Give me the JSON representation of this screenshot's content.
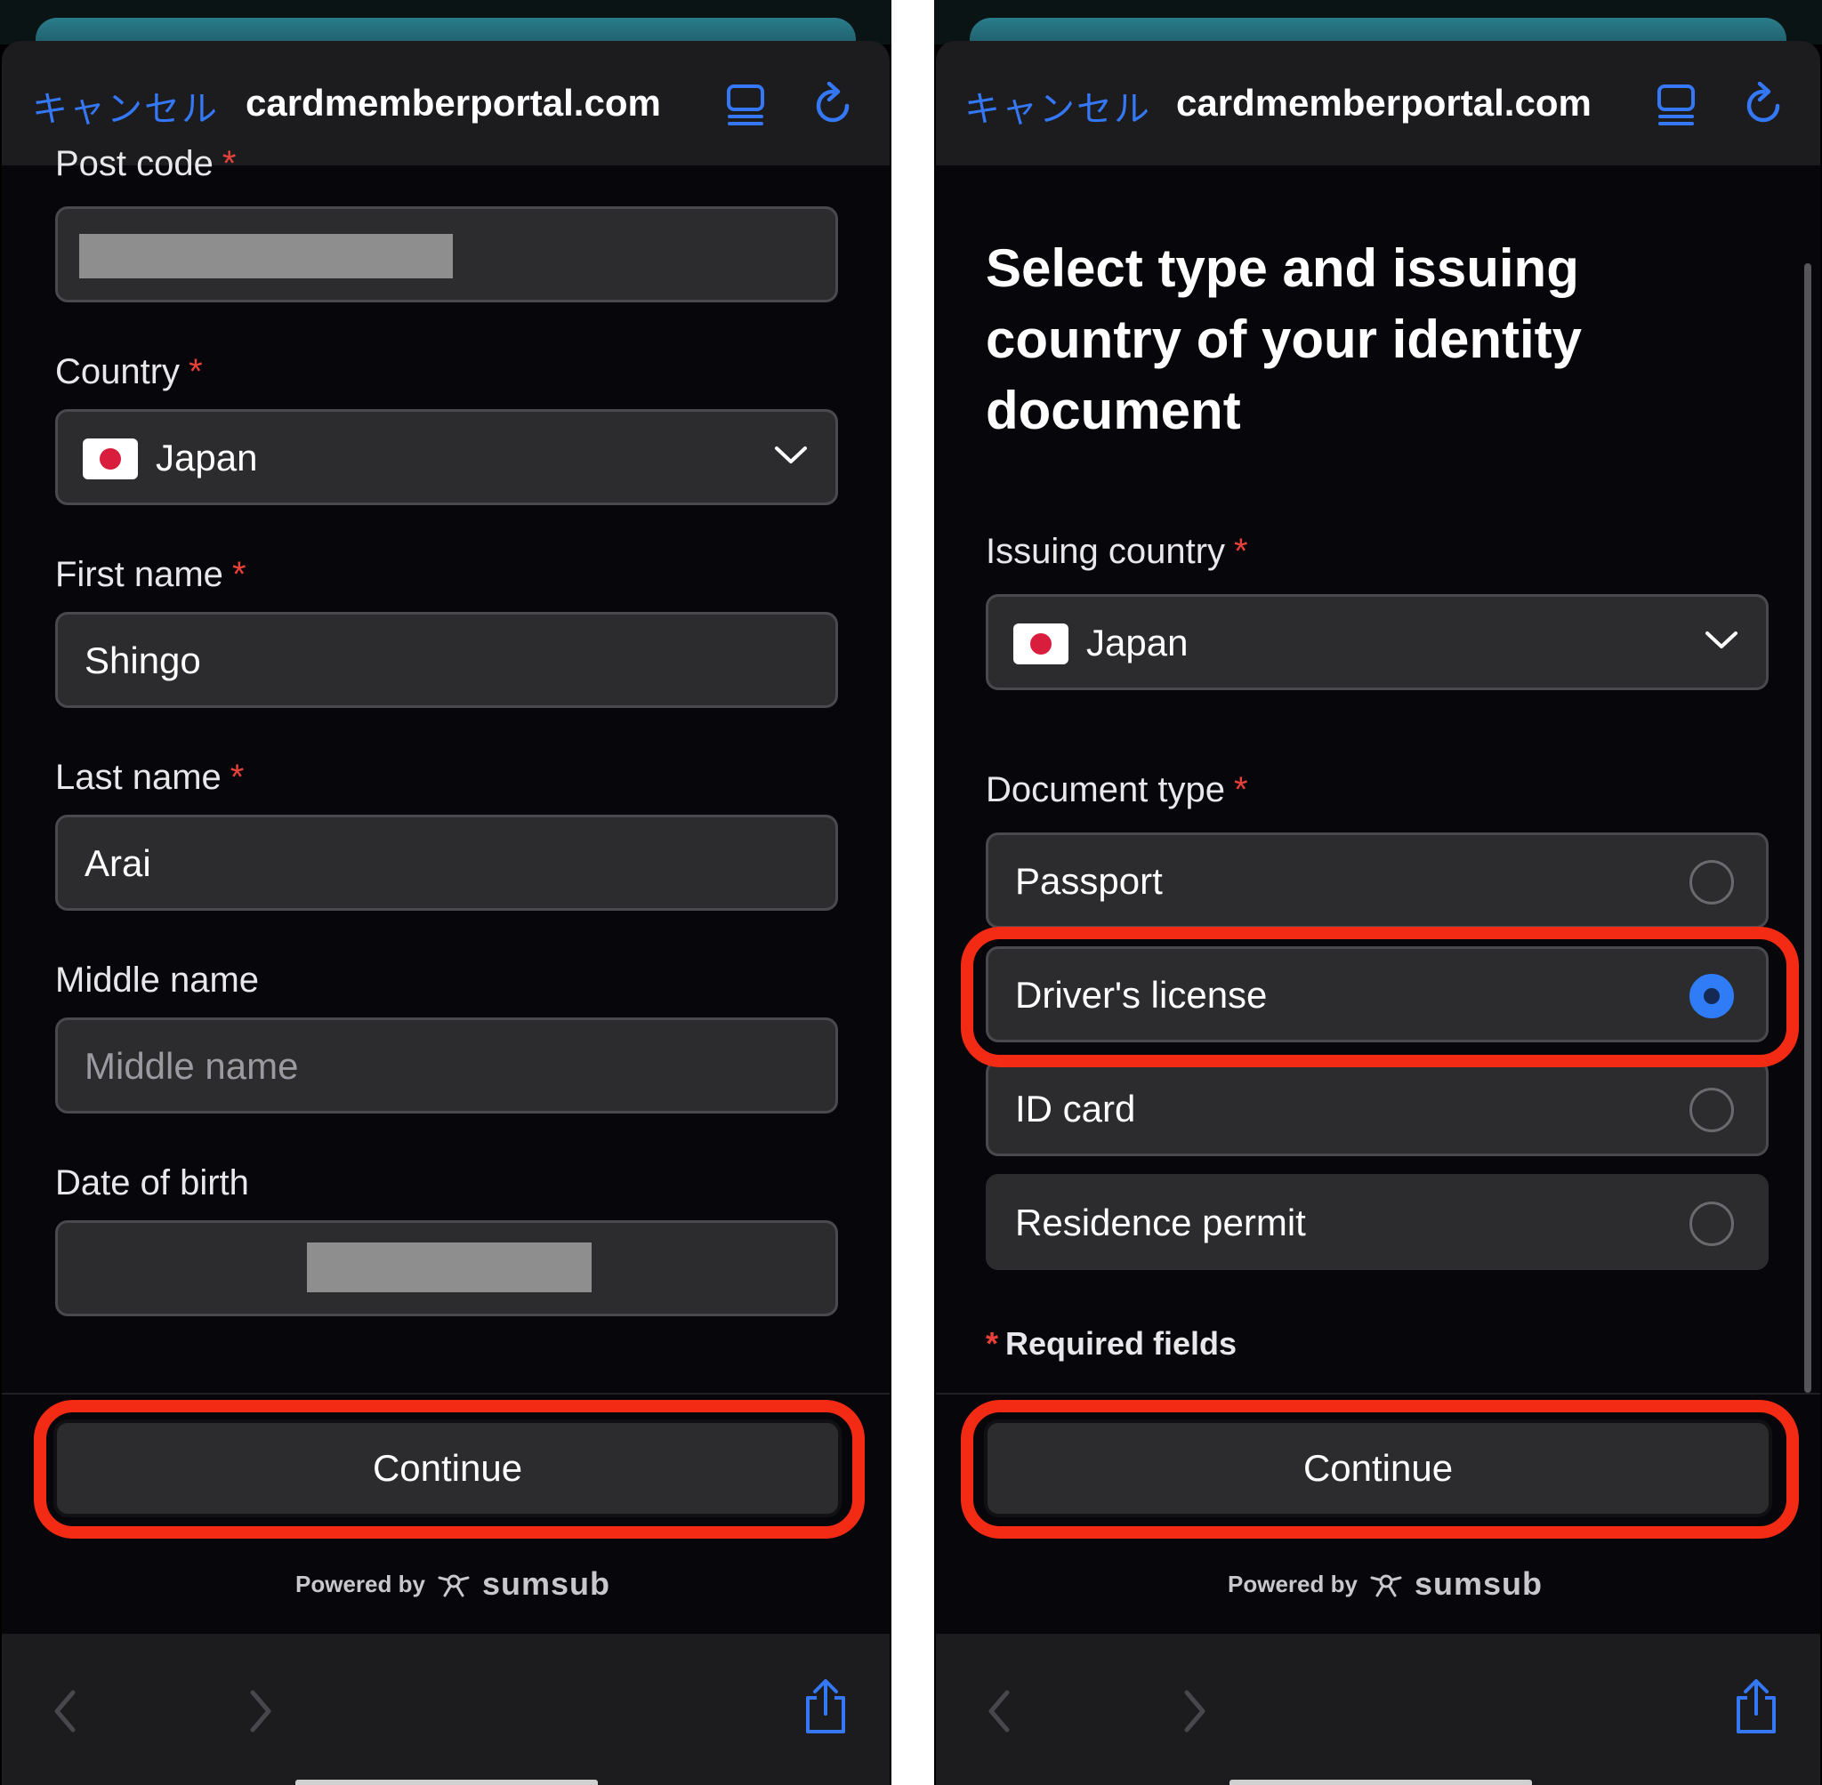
{
  "colors": {
    "accent_blue": "#3478f6",
    "required_red": "#e8413a",
    "highlight_red": "#f42b14",
    "field_bg": "#2c2c2e",
    "page_bg": "#07060a"
  },
  "left": {
    "browser": {
      "cancel": "キャンセル",
      "url": "cardmemberportal.com",
      "icons": [
        "reader-icon",
        "reload-icon"
      ]
    },
    "partial_label": "Post code",
    "country": {
      "label": "Country",
      "value": "Japan",
      "flag": "japan-flag"
    },
    "first_name": {
      "label": "First name",
      "value": "Shingo"
    },
    "last_name": {
      "label": "Last name",
      "value": "Arai"
    },
    "middle_name": {
      "label": "Middle name",
      "placeholder": "Middle name"
    },
    "dob": {
      "label": "Date of birth"
    },
    "required_mark": "*",
    "continue": "Continue",
    "powered_by": "Powered by",
    "brand": "sumsub",
    "toolbar_icons": [
      "back-icon",
      "forward-icon",
      "share-icon"
    ]
  },
  "right": {
    "browser": {
      "cancel": "キャンセル",
      "url": "cardmemberportal.com"
    },
    "title": "Select type and issuing country of your identity document",
    "issuing_country": {
      "label": "Issuing country",
      "value": "Japan"
    },
    "document_type": {
      "label": "Document type",
      "options": [
        {
          "label": "Passport",
          "selected": false
        },
        {
          "label": "Driver's license",
          "selected": true
        },
        {
          "label": "ID card",
          "selected": false
        },
        {
          "label": "Residence permit",
          "selected": false
        }
      ]
    },
    "required_mark": "*",
    "required_note": "Required fields",
    "continue": "Continue",
    "powered_by": "Powered by",
    "brand": "sumsub"
  }
}
